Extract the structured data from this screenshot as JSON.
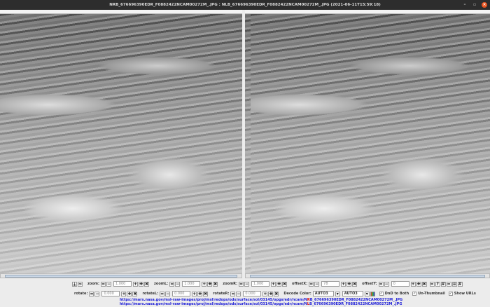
{
  "window": {
    "title": "NRB_676696390EDR_F0882422NCAM00272M_.JPG : NLB_676696390EDR_F0882422NCAM00272M_.JPG (2021-06-11T15:59:18)"
  },
  "controls": {
    "zoom": {
      "label": "zoom:",
      "value": "1.000"
    },
    "zoomL": {
      "label": "zoomL:",
      "value": "1.000"
    },
    "zoomR": {
      "label": "zoomR:",
      "value": "1.000"
    },
    "offsetX": {
      "label": "offsetX:",
      "value": "78"
    },
    "offsetY": {
      "label": "offsetY:",
      "value": "0"
    },
    "rotate": {
      "label": "rotate:",
      "value": "0.000"
    },
    "rotateL": {
      "label": "rotateL:",
      "value": "0.000"
    },
    "rotateR": {
      "label": "rotateR:",
      "value": "0.000"
    },
    "decode_color": {
      "label": "Decode Color:",
      "left": "AUTO3",
      "right": "AUTO3"
    },
    "dnd_label": "DnD to Both",
    "unthumb_label": "Un-Thumbnail",
    "show_urls_label": "Show URLs"
  },
  "urls": {
    "right": {
      "pre": "https://mars.nasa.gov/msl-raw-images/proj/msl/redops/ods/surface/sol/03145/opgs/edr/ncam/N",
      "mark": "R",
      "post": "B_676696390EDR_F0882422NCAM00272M_.JPG"
    },
    "left": {
      "pre": "https://mars.nasa.gov/msl-raw-images/proj/msl/redops/ods/surface/sol/03145/opgs/edr/ncam/N",
      "mark": "L",
      "post": "B_676696390EDR_F0882422NCAM00272M_.JPG"
    }
  }
}
